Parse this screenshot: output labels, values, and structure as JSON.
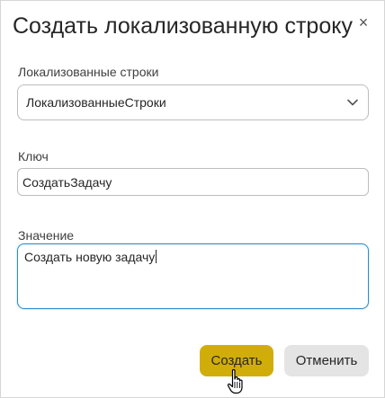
{
  "dialog": {
    "title": "Создать локализованную строку",
    "close_glyph": "×"
  },
  "fields": {
    "strings_label": "Локализованные строки",
    "strings_value": "ЛокализованныеСтроки",
    "key_label": "Ключ",
    "key_value": "СоздатьЗадачу",
    "value_label": "Значение",
    "value_value": "Создать новую задачу"
  },
  "buttons": {
    "create": "Создать",
    "cancel": "Отменить"
  },
  "icons": {
    "close": "close-icon",
    "dropdown": "chevron-down-icon",
    "cursor": "hand-pointer-cursor-icon"
  },
  "colors": {
    "primary_button": "#d1ad0a",
    "secondary_button": "#e4e4e4",
    "focus_border": "#2c8ecc"
  }
}
